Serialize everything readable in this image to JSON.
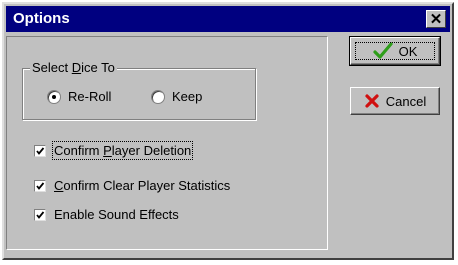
{
  "window": {
    "title": "Options",
    "close_glyph": "✕"
  },
  "dice_group": {
    "legend_pre": "Select ",
    "legend_mnemonic": "D",
    "legend_post": "ice To",
    "options": [
      {
        "label": "Re-Roll",
        "selected": true
      },
      {
        "label": "Keep",
        "selected": false
      }
    ]
  },
  "checkboxes": [
    {
      "pre": "Confirm ",
      "mnemonic": "P",
      "post": "layer Deletion",
      "checked": true,
      "focused": true
    },
    {
      "pre": "",
      "mnemonic": "C",
      "post": "onfirm Clear Player Statistics",
      "checked": true,
      "focused": false
    },
    {
      "pre": "Enable Sound Effects",
      "mnemonic": "",
      "post": "",
      "checked": true,
      "focused": false
    }
  ],
  "buttons": {
    "ok_label": "OK",
    "ok_icon": "checkmark-icon",
    "cancel_label": "Cancel",
    "cancel_icon": "x-icon"
  },
  "colors": {
    "titlebar": "#000080",
    "face": "#c0c0c0",
    "ok_icon": "#2e9e1a",
    "cancel_icon": "#d01010"
  }
}
